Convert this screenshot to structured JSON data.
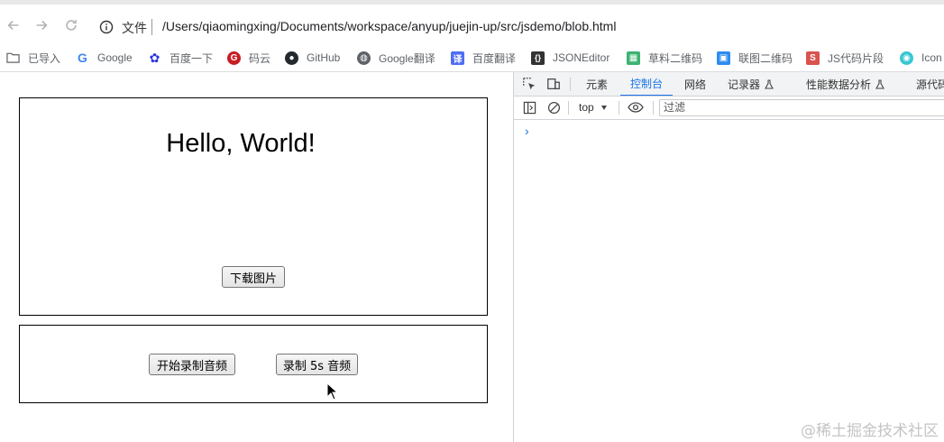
{
  "browser": {
    "protocol_label": "文件",
    "url": "/Users/qiaomingxing/Documents/workspace/anyup/juejin-up/src/jsdemo/blob.html"
  },
  "bookmarks": [
    {
      "label": "已导入",
      "icon": "folder-icon",
      "color": "#5f6368"
    },
    {
      "label": "Google",
      "icon": "google-icon",
      "color": "#4285f4"
    },
    {
      "label": "百度一下",
      "icon": "baidu-icon",
      "color": "#2932e1"
    },
    {
      "label": "码云",
      "icon": "gitee-icon",
      "color": "#c71d23"
    },
    {
      "label": "GitHub",
      "icon": "github-icon",
      "color": "#24292e"
    },
    {
      "label": "Google翻译",
      "icon": "globe-icon",
      "color": "#5f6368"
    },
    {
      "label": "百度翻译",
      "icon": "baidu-translate-icon",
      "color": "#4e6ef2"
    },
    {
      "label": "JSONEditor",
      "icon": "json-icon",
      "color": "#333333"
    },
    {
      "label": "草料二维码",
      "icon": "qrcode-icon",
      "color": "#3cb371"
    },
    {
      "label": "联图二维码",
      "icon": "liantu-icon",
      "color": "#2d8cf0"
    },
    {
      "label": "JS代码片段",
      "icon": "snippet-icon",
      "color": "#d9534f"
    },
    {
      "label": "Icon",
      "icon": "iconfont-icon",
      "color": "#36c6d3"
    }
  ],
  "page": {
    "heading": "Hello, World!",
    "download_button": "下载图片",
    "start_record_button": "开始录制音频",
    "record5s_button": "录制 5s 音频"
  },
  "devtools": {
    "tabs": [
      {
        "label": "元素",
        "active": false
      },
      {
        "label": "控制台",
        "active": true
      },
      {
        "label": "网络",
        "active": false
      },
      {
        "label": "记录器",
        "active": false
      },
      {
        "label": "性能数据分析",
        "active": false
      },
      {
        "label": "源代码",
        "active": false
      }
    ],
    "context": "top",
    "filter_placeholder": "过滤",
    "prompt": "›"
  },
  "watermark": "@稀土掘金技术社区"
}
